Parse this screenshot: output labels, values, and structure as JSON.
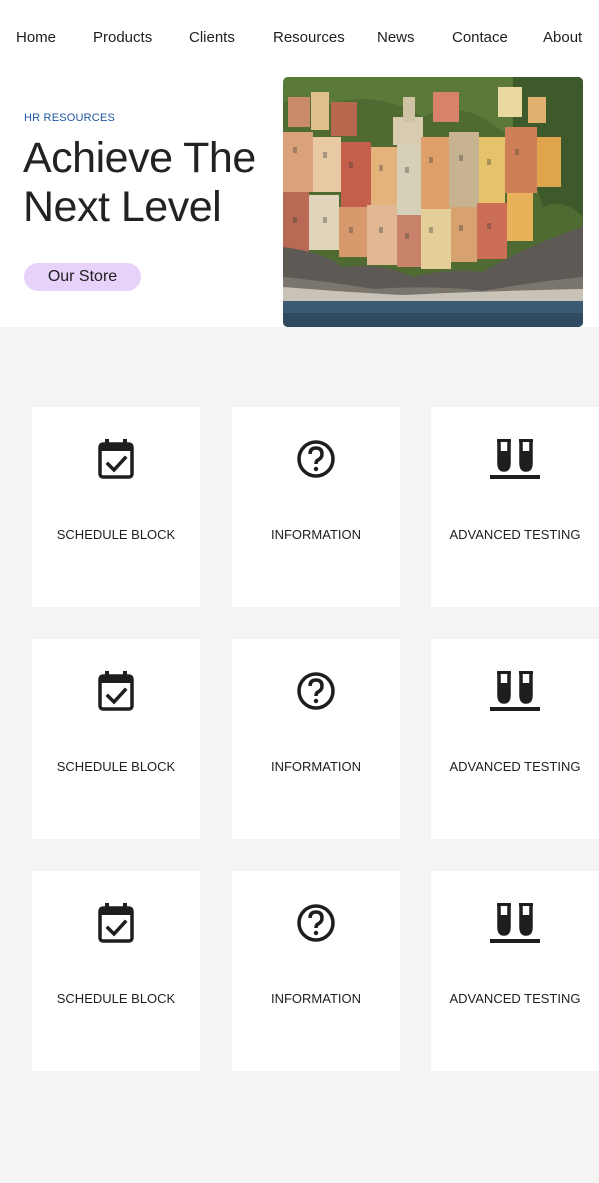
{
  "nav": {
    "items": [
      "Home",
      "Products",
      "Clients",
      "Resources",
      "News",
      "Contace",
      "About"
    ]
  },
  "hero": {
    "eyebrow": "HR RESOURCES",
    "headline_line1": "Achieve The",
    "headline_line2": "Next Level",
    "button_label": "Our Store",
    "image_description_icon": "coastal-village-photo"
  },
  "cards": [
    [
      {
        "label": "SCHEDULE BLOCK",
        "icon": "calendar-check-icon"
      },
      {
        "label": "INFORMATION",
        "icon": "question-circle-icon"
      },
      {
        "label": "ADVANCED TESTING",
        "icon": "test-tubes-icon"
      }
    ],
    [
      {
        "label": "SCHEDULE BLOCK",
        "icon": "calendar-check-icon"
      },
      {
        "label": "INFORMATION",
        "icon": "question-circle-icon"
      },
      {
        "label": "ADVANCED TESTING",
        "icon": "test-tubes-icon"
      }
    ],
    [
      {
        "label": "SCHEDULE BLOCK",
        "icon": "calendar-check-icon"
      },
      {
        "label": "INFORMATION",
        "icon": "question-circle-icon"
      },
      {
        "label": "ADVANCED TESTING",
        "icon": "test-tubes-icon"
      }
    ]
  ],
  "colors": {
    "page_background": "#f4f4f4",
    "card_background": "#ffffff",
    "eyebrow_text": "#1e56a0",
    "button_background": "#e7d2fa",
    "text": "#1e1e1e"
  }
}
